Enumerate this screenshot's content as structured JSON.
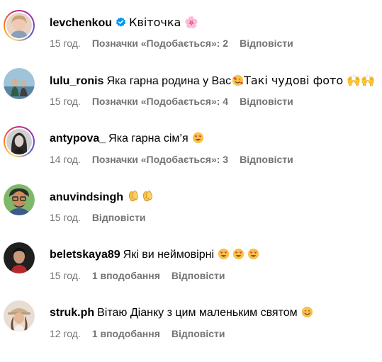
{
  "colors": {
    "meta_text": "#737373",
    "username": "#000000",
    "verified_badge": "#0095f6",
    "heart_eyes_emoji": "#f5c242",
    "clap_emoji": "#f6c34a"
  },
  "comments": [
    {
      "username": "levchenkou",
      "verified": true,
      "avatar_ring": true,
      "text": "Квіточка 🌸",
      "emojis": [],
      "time": "15 год.",
      "likes": "Позначки «Подобається»: 2",
      "reply": "Відповісти"
    },
    {
      "username": "lulu_ronis",
      "verified": false,
      "avatar_ring": false,
      "text": "Яка гарна родина у Вас",
      "text_after_emoji": "Такі чудові фото 🙌🙌",
      "emojis": [
        "smiling-face-with-hearts-emoji"
      ],
      "time": "15 год.",
      "likes": "Позначки «Подобається»: 4",
      "reply": "Відповісти"
    },
    {
      "username": "antypova_",
      "verified": false,
      "avatar_ring": true,
      "text": "Яка гарна сім’я",
      "emojis": [
        "heart-eyes-emoji"
      ],
      "time": "14 год.",
      "likes": "Позначки «Подобається»: 3",
      "reply": "Відповісти"
    },
    {
      "username": "anuvindsingh",
      "verified": false,
      "avatar_ring": false,
      "text": "",
      "emojis": [
        "clapping-hands-emoji",
        "clapping-hands-emoji"
      ],
      "time": "15 год.",
      "likes": "",
      "reply": "Відповісти"
    },
    {
      "username": "beletskaya89",
      "verified": false,
      "avatar_ring": false,
      "text": "Які ви неймовірні",
      "emojis": [
        "heart-eyes-emoji",
        "heart-eyes-emoji",
        "heart-eyes-emoji"
      ],
      "time": "15 год.",
      "likes": "1 вподобання",
      "reply": "Відповісти"
    },
    {
      "username": "struk.ph",
      "verified": false,
      "avatar_ring": false,
      "text": "Вітаю Діанку з цим маленьким святом",
      "emojis": [
        "smiling-face-with-hearts-emoji"
      ],
      "time": "12 год.",
      "likes": "1 вподобання",
      "reply": "Відповісти"
    }
  ]
}
